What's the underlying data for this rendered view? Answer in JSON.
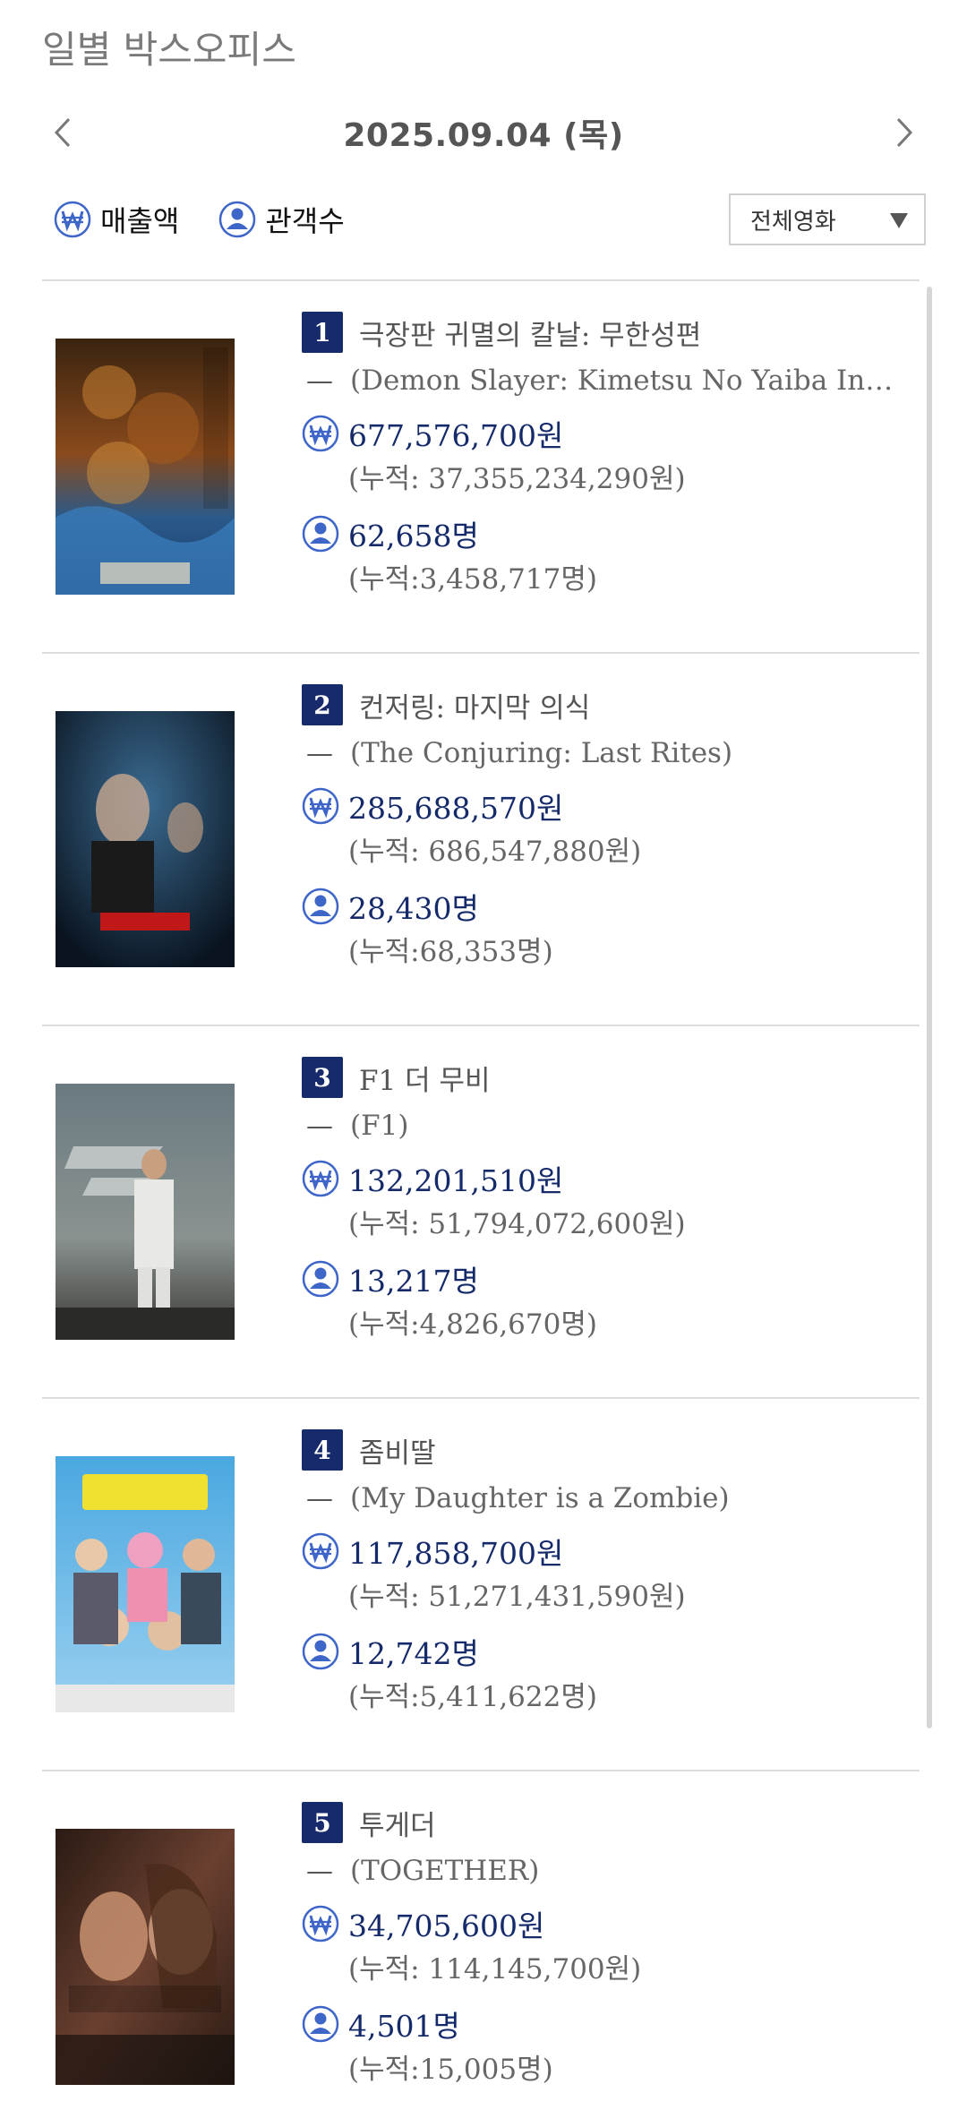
{
  "page": {
    "title": "일별 박스오피스"
  },
  "date_nav": {
    "date": "2025.09.04 (목)"
  },
  "legend": {
    "revenue_label": "매출액",
    "audience_label": "관객수"
  },
  "filter": {
    "selected": "전체영화"
  },
  "colors": {
    "navy": "#172a6b",
    "icon_blue": "#3e65c8",
    "divider": "#dcdcdc"
  },
  "movies": [
    {
      "rank": "1",
      "title_ko": "극장판 귀멸의 칼날: 무한성편",
      "dash": "—",
      "title_en": "(Demon Slayer: Kimetsu No Yaiba Infinity…",
      "revenue": "677,576,700원",
      "revenue_cum": "(누적: 37,355,234,290원)",
      "audience": "62,658명",
      "audience_cum": "(누적:3,458,717명)"
    },
    {
      "rank": "2",
      "title_ko": "컨저링: 마지막 의식",
      "dash": "—",
      "title_en": "(The Conjuring: Last Rites)",
      "revenue": "285,688,570원",
      "revenue_cum": "(누적: 686,547,880원)",
      "audience": "28,430명",
      "audience_cum": "(누적:68,353명)"
    },
    {
      "rank": "3",
      "title_ko": "F1 더 무비",
      "dash": "—",
      "title_en": "(F1)",
      "revenue": "132,201,510원",
      "revenue_cum": "(누적: 51,794,072,600원)",
      "audience": "13,217명",
      "audience_cum": "(누적:4,826,670명)"
    },
    {
      "rank": "4",
      "title_ko": "좀비딸",
      "dash": "—",
      "title_en": "(My Daughter is a Zombie)",
      "revenue": "117,858,700원",
      "revenue_cum": "(누적: 51,271,431,590원)",
      "audience": "12,742명",
      "audience_cum": "(누적:5,411,622명)"
    },
    {
      "rank": "5",
      "title_ko": "투게더",
      "dash": "—",
      "title_en": "(TOGETHER)",
      "revenue": "34,705,600원",
      "revenue_cum": "(누적: 114,145,700원)",
      "audience": "4,501명",
      "audience_cum": "(누적:15,005명)"
    }
  ]
}
